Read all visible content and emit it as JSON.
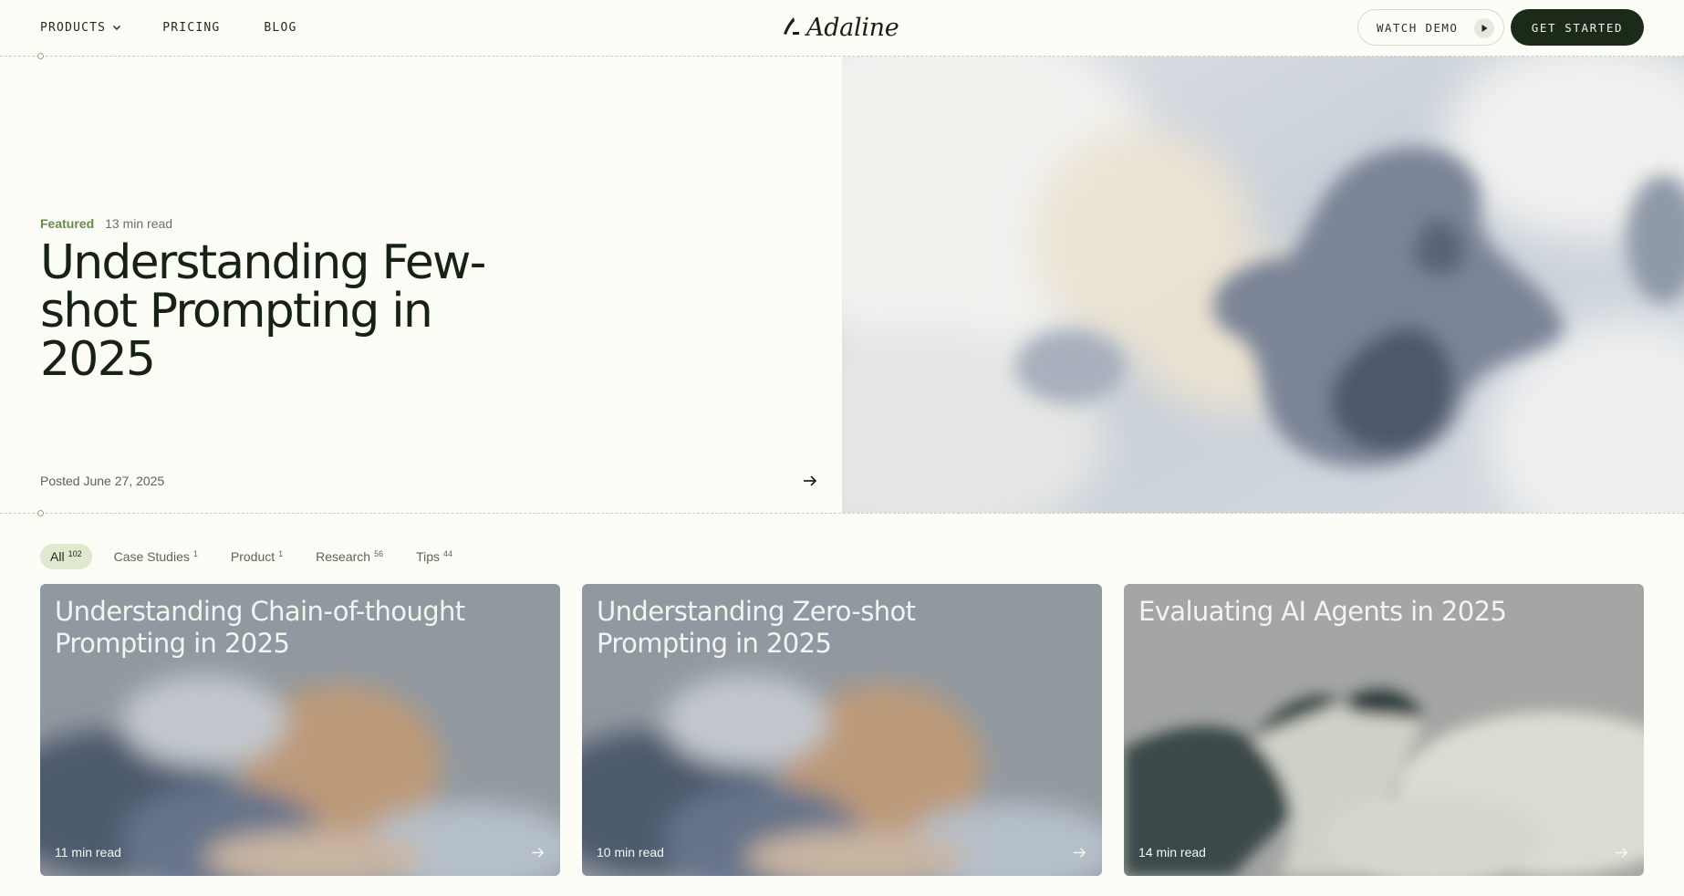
{
  "nav": {
    "products": "PRODUCTS",
    "pricing": "PRICING",
    "blog": "BLOG",
    "logo": "Adaline",
    "watch_demo": "WATCH DEMO",
    "get_started": "GET STARTED"
  },
  "hero": {
    "tag": "Featured",
    "read_time": "13 min read",
    "title": "Understanding Few-shot Prompting in 2025",
    "posted": "Posted June 27, 2025"
  },
  "filters": [
    {
      "label": "All",
      "count": "102",
      "active": true
    },
    {
      "label": "Case Studies",
      "count": "1"
    },
    {
      "label": "Product",
      "count": "1"
    },
    {
      "label": "Research",
      "count": "56"
    },
    {
      "label": "Tips",
      "count": "44"
    }
  ],
  "cards": [
    {
      "title": "Understanding Chain-of-thought Prompting in 2025",
      "read_time": "11 min read"
    },
    {
      "title": "Understanding Zero-shot Prompting in 2025",
      "read_time": "10 min read"
    },
    {
      "title": "Evaluating AI Agents in 2025",
      "read_time": "14 min read"
    }
  ],
  "icons": {
    "chevron": "chevron-down-icon",
    "play": "play-icon",
    "arrow": "arrow-right-icon",
    "logo_mark": "adaline-logo-icon"
  },
  "colors": {
    "background": "#fbfdf6",
    "primary_button": "#1c2a19",
    "featured_accent": "#6a8a4a",
    "active_chip": "#dfe9cf"
  }
}
